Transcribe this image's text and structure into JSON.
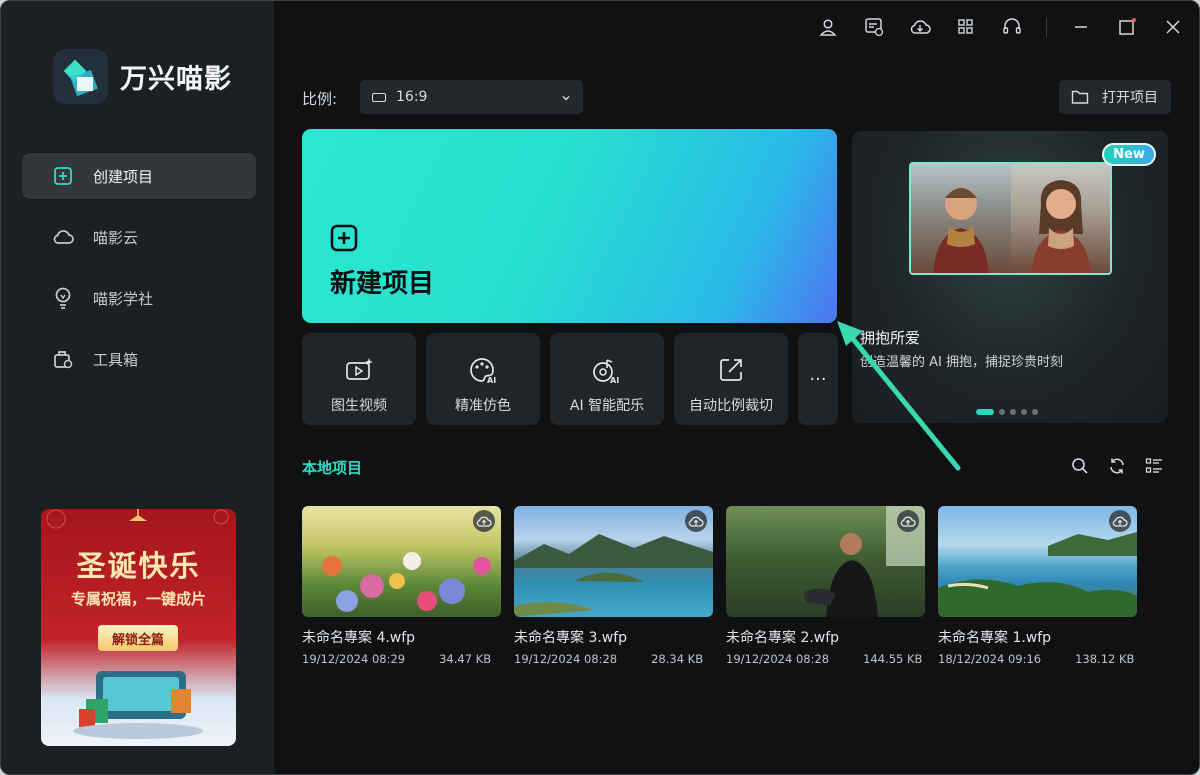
{
  "app": {
    "name": "万兴喵影"
  },
  "sidebar": {
    "items": [
      {
        "label": "创建项目",
        "icon": "plus-square-icon",
        "active": true
      },
      {
        "label": "喵影云",
        "icon": "cloud-icon",
        "active": false
      },
      {
        "label": "喵影学社",
        "icon": "bulb-icon",
        "active": false
      },
      {
        "label": "工具箱",
        "icon": "toolbox-icon",
        "active": false
      }
    ],
    "promo": {
      "title": "圣诞快乐",
      "subtitle": "专属祝福，一键成片",
      "button": "解锁全篇"
    }
  },
  "topbar": {
    "icons": [
      "user-icon",
      "message-icon",
      "cloud-sync-icon",
      "apps-grid-icon",
      "headset-icon",
      "minimize-icon",
      "maximize-icon",
      "close-icon"
    ]
  },
  "ratio": {
    "label": "比例:",
    "value": "16:9"
  },
  "open_project": {
    "label": "打开项目"
  },
  "new_project": {
    "label": "新建项目"
  },
  "tools": [
    {
      "label": "图生视频",
      "icon": "image-to-video-icon"
    },
    {
      "label": "精准仿色",
      "icon": "palette-ai-icon"
    },
    {
      "label": "AI 智能配乐",
      "icon": "music-ai-icon"
    },
    {
      "label": "自动比例裁切",
      "icon": "auto-crop-icon"
    }
  ],
  "tools_more": "···",
  "banner": {
    "badge": "New",
    "title": "拥抱所爱",
    "description": "创造温馨的 AI 拥抱，捕捉珍贵时刻",
    "dots_count": 5,
    "active_dot": 0
  },
  "local": {
    "title": "本地项目",
    "projects": [
      {
        "name": "未命名專案 4.wfp",
        "date": "19/12/2024 08:29",
        "size": "34.47 KB"
      },
      {
        "name": "未命名專案 3.wfp",
        "date": "19/12/2024 08:28",
        "size": "28.34 KB"
      },
      {
        "name": "未命名專案 2.wfp",
        "date": "19/12/2024 08:28",
        "size": "144.55 KB"
      },
      {
        "name": "未命名專案 1.wfp",
        "date": "18/12/2024 09:16",
        "size": "138.12 KB"
      }
    ]
  },
  "colors": {
    "accent": "#2fdcc4",
    "background": "#0f1113",
    "sidebar": "#1d2023"
  }
}
